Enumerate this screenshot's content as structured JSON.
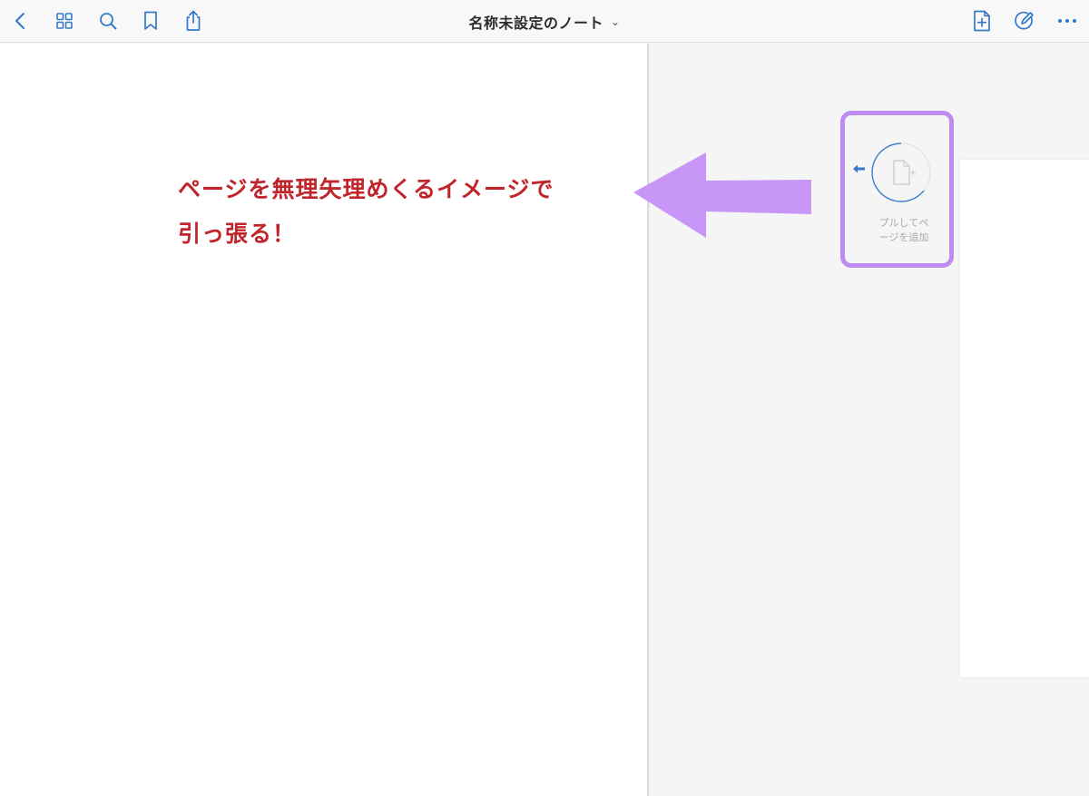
{
  "toolbar": {
    "title": "名称未設定のノート",
    "title_chevron": "⌄",
    "accent_color": "#3478c8",
    "left_icons": [
      "back-chevron-icon",
      "grid-icon",
      "search-icon",
      "bookmark-icon",
      "share-icon"
    ],
    "right_icons": [
      "add-page-icon",
      "pen-icon",
      "more-icon"
    ]
  },
  "pull_to_add": {
    "label_line1": "プルしてペ",
    "label_line2": "ージを追加",
    "highlight_color": "#bd8cf2"
  },
  "annotation": {
    "line1": "ページを無理矢理めくるイメージで",
    "line2": "引っ張る！",
    "color": "#c0252c",
    "arrow_color": "#c896f6"
  }
}
